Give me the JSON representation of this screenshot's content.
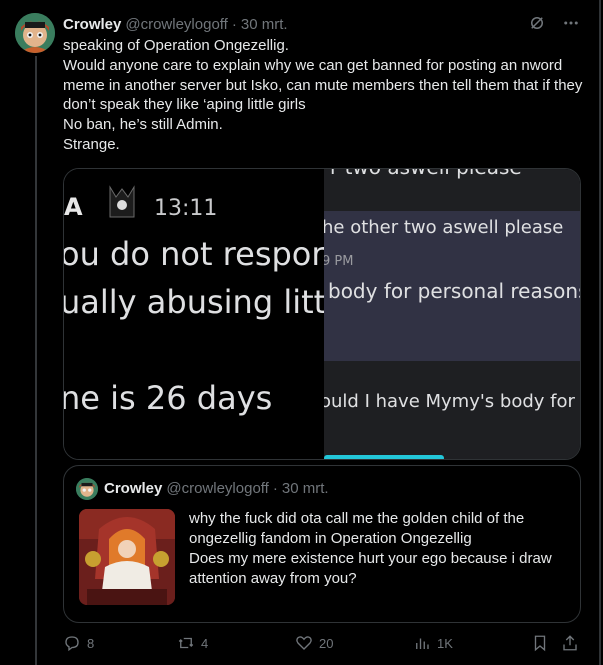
{
  "tweet": {
    "author_name": "Crowley",
    "author_handle": "@crowleylogoff",
    "separator": "·",
    "date": "30 mrt.",
    "text_lines": [
      "speaking of Operation Ongezellig.",
      "Would anyone care to explain why we can get banned for posting an nword meme in another server but Isko, can mute members then tell them that if they don’t speak they like ‘aping little girls",
      "No ban, he’s still Admin.",
      "Strange."
    ]
  },
  "top_icons": [
    "grok-icon",
    "more-icon"
  ],
  "media": {
    "left": {
      "badge": "A",
      "time": "13:11",
      "line1": "ou do not respor",
      "line2": "ually abusing litt",
      "line3": "ne is 26 days"
    },
    "right": {
      "top_cut": "r two aswell please",
      "line1": "he other two aswell please",
      "time": "9 PM",
      "line2": "body for personal reasons",
      "line3": "ould I have Mymy's body for pers"
    }
  },
  "quote": {
    "author_name": "Crowley",
    "author_handle": "@crowleylogoff",
    "separator": "·",
    "date": "30 mrt.",
    "text": "why the fuck did ota call me the golden child of the ongezellig fandom in Operation Ongezellig\nDoes my mere existence hurt your ego because i draw attention away from you?"
  },
  "actions": {
    "reply_count": "8",
    "repost_count": "4",
    "like_count": "20",
    "views_count": "1K"
  }
}
